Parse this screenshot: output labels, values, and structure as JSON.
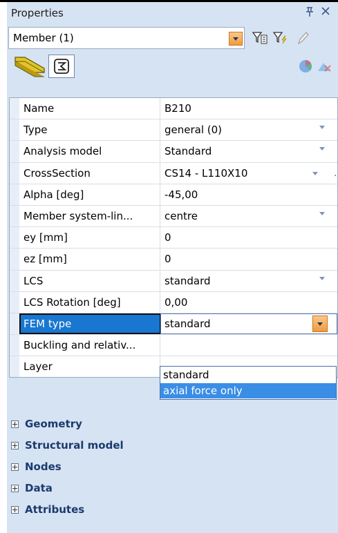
{
  "panel": {
    "title": "Properties",
    "pin_glyph": "ɨ",
    "close_glyph": "×"
  },
  "selector": {
    "value": "Member (1)",
    "icons": [
      "filter-select-icon",
      "filter-lightning-icon",
      "pencil-icon"
    ]
  },
  "toolbar": {
    "tabs": [
      "member-beam-icon",
      "cross-section-icon"
    ],
    "right_icons": [
      "pie-chart-icon",
      "clear-icon"
    ]
  },
  "properties": [
    {
      "label": "Name",
      "value": "B210",
      "control": "none"
    },
    {
      "label": "Type",
      "value": "general (0)",
      "control": "dropdown"
    },
    {
      "label": "Analysis model",
      "value": "Standard",
      "control": "dropdown"
    },
    {
      "label": "CrossSection",
      "value": "CS14 - L110X10",
      "control": "dropdown-ellipsis"
    },
    {
      "label": "Alpha [deg]",
      "value": "-45,00",
      "control": "none"
    },
    {
      "label": "Member system-lin...",
      "value": "centre",
      "control": "dropdown"
    },
    {
      "label": "ey [mm]",
      "value": "0",
      "control": "none"
    },
    {
      "label": "ez [mm]",
      "value": "0",
      "control": "none"
    },
    {
      "label": "LCS",
      "value": "standard",
      "control": "dropdown"
    },
    {
      "label": "LCS Rotation [deg]",
      "value": "0,00",
      "control": "none"
    },
    {
      "label": "FEM type",
      "value": "standard",
      "control": "dropdown-open"
    },
    {
      "label": "Buckling and relativ...",
      "value": "",
      "control": "none"
    },
    {
      "label": "Layer",
      "value": "",
      "control": "ellipsis"
    }
  ],
  "dropdown": {
    "options": [
      "standard",
      "axial force only"
    ],
    "highlighted": "axial force only"
  },
  "ellipsis_label": "...",
  "categories": [
    "Geometry",
    "Structural model",
    "Nodes",
    "Data",
    "Attributes"
  ],
  "colors": {
    "accent": "#1877d0",
    "panel_bg": "#d6e3f2",
    "category_text": "#1b3a6e"
  }
}
